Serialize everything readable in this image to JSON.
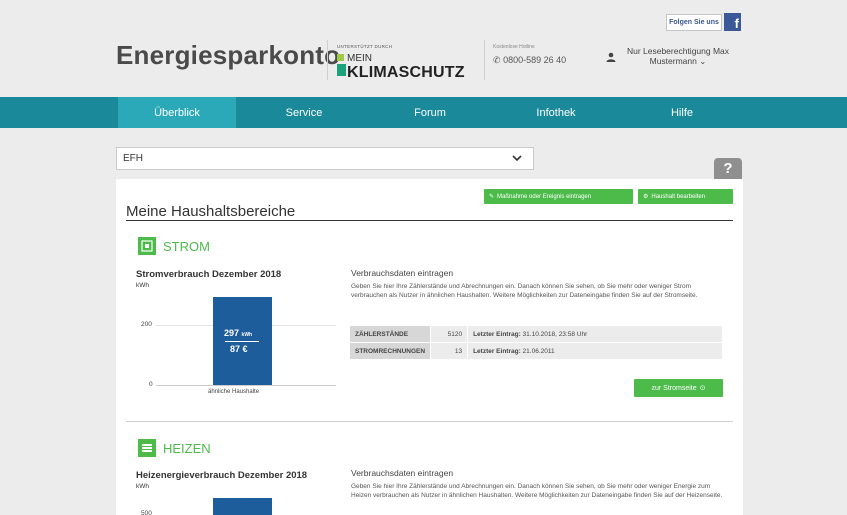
{
  "header": {
    "follow_label": "Folgen Sie uns",
    "fb_letter": "f",
    "brand": "Energiesparkonto",
    "supported_by": "UNTERSTÜTZT DURCH",
    "mk_mein": "MEIN",
    "mk_klima": "KLIMASCHUTZ",
    "hotline_label": "Kostenlose Hotline",
    "hotline_number": "0800-589 26 40",
    "user_text": "Nur Leseberechtigung Max Mustermann"
  },
  "nav": {
    "items": [
      "Überblick",
      "Service",
      "Forum",
      "Infothek",
      "Hilfe"
    ],
    "active_index": 0
  },
  "select": {
    "value": "EFH"
  },
  "help_label": "?",
  "card": {
    "btn_measure": "Maßnahme oder Ereignis eintragen",
    "btn_household": "Haushalt bearbeiten",
    "title": "Meine Haushaltsbereiche"
  },
  "strom": {
    "title": "STROM",
    "chart_title": "Stromverbrauch Dezember 2018",
    "unit": "kWh",
    "tick_200": "200",
    "tick_0": "0",
    "bar_kwh": "297",
    "bar_kwh_unit": "kWh",
    "bar_eur": "87 €",
    "category": "ähnliche Haushalte",
    "vd_head": "Verbrauchsdaten eintragen",
    "vd_text": "Geben Sie hier Ihre Zählerstände und Abrechnungen ein. Danach können Sie sehen, ob Sie mehr oder weniger Strom verbrauchen als Nutzer in ähnlichen Haushalten. Weitere Möglichkeiten zur Dateneingabe finden Sie auf der Stromseite.",
    "rows": [
      {
        "key": "ZÄHLERSTÄNDE",
        "count": "5120",
        "last_label": "Letzter Eintrag:",
        "last_value": "31.10.2018, 23:58 Uhr"
      },
      {
        "key": "STROMRECHNUNGEN",
        "count": "13",
        "last_label": "Letzter Eintrag:",
        "last_value": "21.06.2011"
      }
    ],
    "link_label": "zur Stromseite"
  },
  "heizen": {
    "title": "HEIZEN",
    "chart_title": "Heizenergieverbrauch Dezember 2018",
    "unit": "kWh",
    "tick_top": "500",
    "vd_head": "Verbrauchsdaten eintragen",
    "vd_text": "Geben Sie hier Ihre Zählerstände und Abrechnungen ein. Danach können Sie sehen, ob Sie mehr oder weniger Energie zum Heizen verbrauchen als Nutzer in ähnlichen Haushalten. Weitere Möglichkeiten zur Dateneingabe finden Sie auf der Heizenseite."
  },
  "colors": {
    "nav": "#1a8a9a",
    "nav_active": "#2ba9b9",
    "green": "#4cbb4a",
    "bar": "#1e5d9c"
  }
}
